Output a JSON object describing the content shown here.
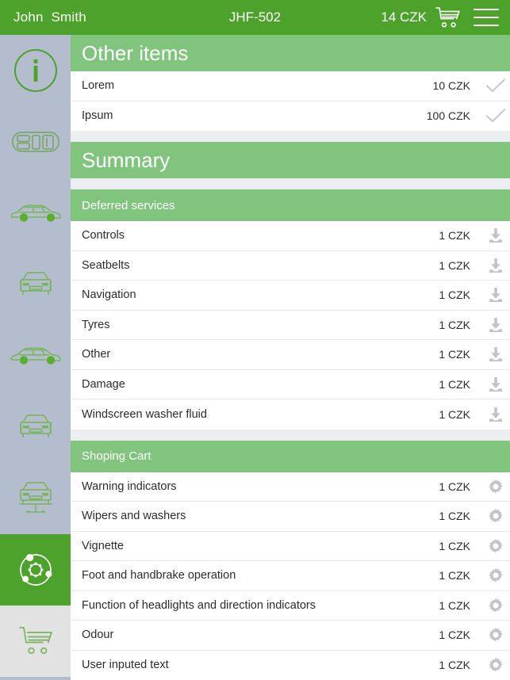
{
  "colors": {
    "topbar_green": "#4CA22B",
    "section_green": "#80C47E",
    "sidebar_bg": "#B4BDCE",
    "page_bg": "#eceef1",
    "row_bg": "#ffffff",
    "icon_gray": "#c3c3c3",
    "text": "#2c2c2c"
  },
  "topbar": {
    "user_name": "John  Smith",
    "plate": "JHF-502",
    "cart_total": "14 CZK",
    "cart_icon": "shopping-cart-icon",
    "menu_icon": "hamburger-menu-icon"
  },
  "sidebar": {
    "items": [
      {
        "name": "info",
        "icon": "info-circle-icon",
        "active": false
      },
      {
        "name": "dashboard",
        "icon": "car-interior-icon",
        "active": false
      },
      {
        "name": "exterior-side",
        "icon": "car-side-icon",
        "active": false
      },
      {
        "name": "front",
        "icon": "car-front-icon",
        "active": false
      },
      {
        "name": "side-two",
        "icon": "car-side-icon",
        "active": false
      },
      {
        "name": "front-two",
        "icon": "car-front-icon",
        "active": false
      },
      {
        "name": "underbody",
        "icon": "car-on-lift-icon",
        "active": false
      },
      {
        "name": "services",
        "icon": "gear-orbit-icon",
        "active": true
      },
      {
        "name": "cart",
        "icon": "shopping-cart-icon",
        "active": false
      }
    ]
  },
  "sections": [
    {
      "title": "Other items",
      "style": "big",
      "action_icon": "check-icon",
      "rows": [
        {
          "label": "Lorem",
          "price": "10 CZK"
        },
        {
          "label": "Ipsum",
          "price": "100 CZK"
        }
      ]
    },
    {
      "title": "Summary",
      "style": "big",
      "action_icon": "",
      "rows": []
    },
    {
      "title": "Deferred services",
      "style": "small",
      "action_icon": "download-icon",
      "rows": [
        {
          "label": "Controls",
          "price": "1 CZK"
        },
        {
          "label": "Seatbelts",
          "price": "1 CZK"
        },
        {
          "label": "Navigation",
          "price": "1 CZK"
        },
        {
          "label": "Tyres",
          "price": "1 CZK"
        },
        {
          "label": "Other",
          "price": "1 CZK"
        },
        {
          "label": "Damage",
          "price": "1 CZK"
        },
        {
          "label": "Windscreen washer fluid",
          "price": "1 CZK"
        }
      ]
    },
    {
      "title": "Shoping Cart",
      "style": "small",
      "action_icon": "gear-icon",
      "rows": [
        {
          "label": "Warning indicators",
          "price": "1 CZK"
        },
        {
          "label": "Wipers and washers",
          "price": "1 CZK"
        },
        {
          "label": "Vignette",
          "price": "1 CZK"
        },
        {
          "label": "Foot and handbrake operation",
          "price": "1 CZK"
        },
        {
          "label": "Function of headlights and direction indicators",
          "price": "1 CZK"
        },
        {
          "label": "Odour",
          "price": "1 CZK"
        },
        {
          "label": "User inputed text",
          "price": "1 CZK"
        }
      ]
    }
  ]
}
